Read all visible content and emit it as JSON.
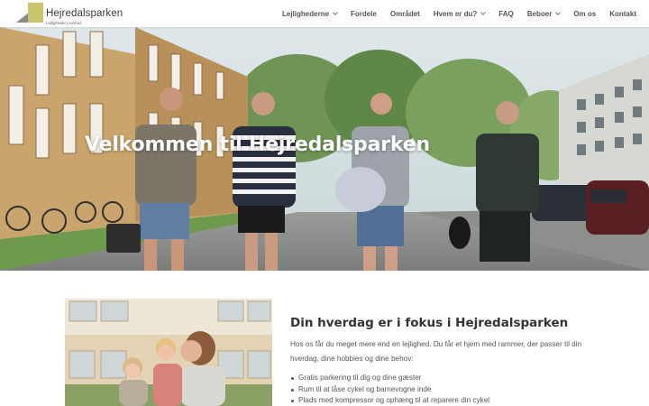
{
  "brand": {
    "name": "Hejredalsparken",
    "tagline": "Lejligheder i Aarhus",
    "colors": {
      "mark_gold": "#c9c56e",
      "mark_grey": "#8a8a8a"
    }
  },
  "nav": {
    "items": [
      {
        "label": "Lejlighederne",
        "dropdown": true
      },
      {
        "label": "Fordele",
        "dropdown": false
      },
      {
        "label": "Området",
        "dropdown": false
      },
      {
        "label": "Hvem er du?",
        "dropdown": true
      },
      {
        "label": "FAQ",
        "dropdown": false
      },
      {
        "label": "Beboer",
        "dropdown": true
      },
      {
        "label": "Om os",
        "dropdown": false
      },
      {
        "label": "Kontakt",
        "dropdown": false
      }
    ]
  },
  "hero": {
    "title": "Velkommen til Hejredalsparken"
  },
  "intro": {
    "heading": "Din hverdag er i fokus i Hejredalsparken",
    "paragraph": "Hos os får du meget mere end en lejlighed. Du får et hjem med rammer, der passer til din hverdag, dine hobbies og dine behov:",
    "bullets": [
      "Gratis parkering til dig og dine gæster",
      "Rum til at låse cykel og barnevogne inde",
      "Plads med kompressor og ophæng til at reparere din cykel"
    ]
  }
}
